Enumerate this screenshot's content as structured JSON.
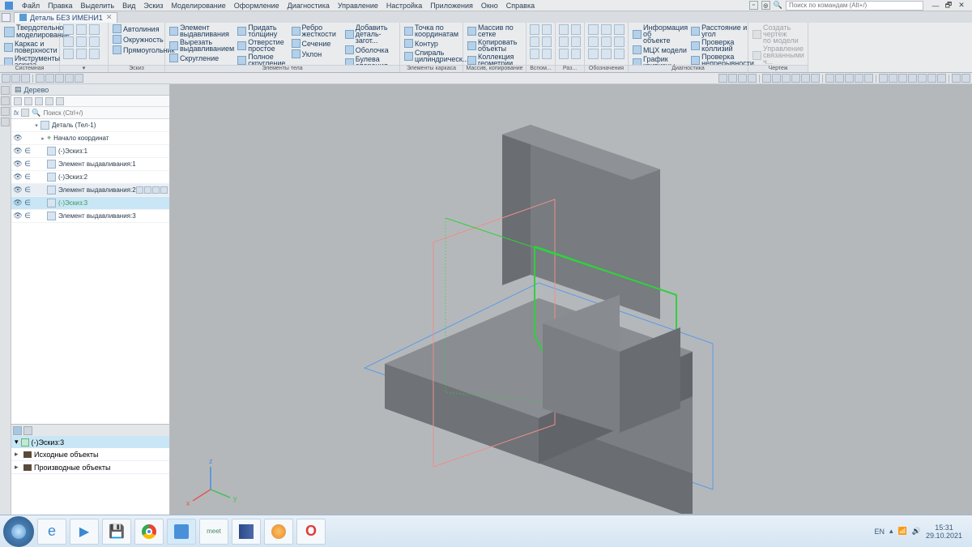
{
  "titlebar": {
    "menus": [
      "Файл",
      "Правка",
      "Выделить",
      "Вид",
      "Эскиз",
      "Моделирование",
      "Оформление",
      "Диагностика",
      "Управление",
      "Настройка",
      "Приложения",
      "Окно",
      "Справка"
    ],
    "search_placeholder": "Поиск по командам (Alt+/)"
  },
  "tab": {
    "name": "Деталь БЕЗ ИМЕНИ1"
  },
  "ribbon": {
    "col0": {
      "header": "Твердотельное\nмоделирование",
      "items": [
        "Каркас и\nповерхности",
        "Инструменты\nэскиза"
      ]
    },
    "solid_label": "Системная",
    "sketch": {
      "label": "Эскиз",
      "items": [
        "Автолиния",
        "Окружность",
        "Прямоугольник"
      ]
    },
    "body": {
      "label": "Элементы тела",
      "items": [
        [
          "Элемент\nвыдавливания",
          "Вырезать\nвыдавливанием",
          "Скругление"
        ],
        [
          "Придать\nтолщину",
          "Отверстие\nпростое",
          "Полное\nскругление"
        ],
        [
          "Ребро\nжесткости",
          "Сечение",
          "Уклон"
        ],
        [
          "Добавить\nдеталь-загот...",
          "Оболочка",
          "Булева\nоперация"
        ]
      ]
    },
    "frame": {
      "label": "Элементы каркаса",
      "items": [
        "Точка по\nкоординатам",
        "Контур",
        "Спираль\nцилиндрическ..."
      ]
    },
    "array": {
      "label": "Массив, копирование",
      "items": [
        "Массив по сетке",
        "Копировать\nобъекты",
        "Коллекция\nгеометрии"
      ]
    },
    "aux": {
      "label": "Вспом..."
    },
    "dim": {
      "label": "Раз..."
    },
    "annot": {
      "label": "Обозначения",
      "items": [
        "Информация об\nобъекте",
        "МЦХ модели",
        "График\nкривизны",
        "Расстояние и\nугол",
        "Проверка\nколлизий",
        "Проверка\nнепрерывности"
      ]
    },
    "diag": {
      "label": "Диагностика"
    },
    "draw": {
      "label": "Чертеж",
      "items": [
        "Создать чертеж\nпо модели",
        "Управление\nсвязанными ч..."
      ]
    }
  },
  "sidebar": {
    "title": "Дерево",
    "search_placeholder": "Поиск (Ctrl+/)",
    "fx": "fx",
    "root": {
      "label": "Деталь (Тел-1)"
    },
    "items": [
      {
        "label": "Начало координат",
        "indent": 1,
        "exp": "▸"
      },
      {
        "label": "(-)Эскиз:1",
        "indent": 1,
        "vis": true,
        "inc": true
      },
      {
        "label": "Элемент выдавливания:1",
        "indent": 1,
        "vis": true,
        "inc": true
      },
      {
        "label": "(-)Эскиз:2",
        "indent": 1,
        "vis": true,
        "inc": true
      },
      {
        "label": "Элемент выдавливания:2",
        "indent": 1,
        "vis": true,
        "inc": true,
        "sel": true,
        "extra": true
      },
      {
        "label": "(-)Эскиз:3",
        "indent": 1,
        "vis": true,
        "inc": true,
        "sel": true,
        "green": true
      },
      {
        "label": "Элемент выдавливания:3",
        "indent": 1,
        "vis": true,
        "inc": true
      }
    ],
    "bottom": {
      "header": "(-)Эскиз:3",
      "rows": [
        "Исходные объекты",
        "Производные объекты"
      ]
    }
  },
  "taskbar": {
    "lang": "EN",
    "time": "15:31",
    "date": "29.10.2021",
    "meet": "meet"
  }
}
